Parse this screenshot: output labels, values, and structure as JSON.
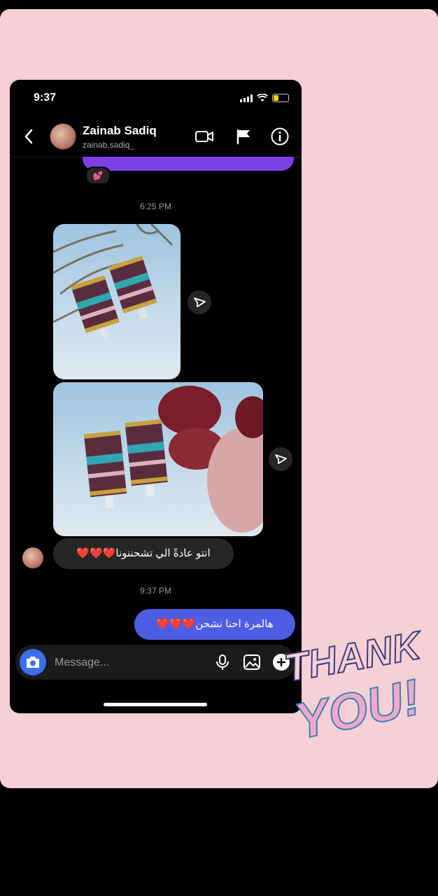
{
  "status_bar": {
    "time": "9:37"
  },
  "header": {
    "name": "Zainab Sadiq",
    "handle": "zainab.sadiq_"
  },
  "conversation": {
    "reaction": "💕",
    "timestamp_1": "6:25 PM",
    "incoming_message": "انتو عادةً الي تشحننونا❤️❤️❤️",
    "timestamp_2": "9:37 PM",
    "outgoing_message": "هالمرة احنا نشحن❤️❤️❤️"
  },
  "composer": {
    "placeholder": "Message..."
  },
  "sticker": {
    "line1": "THANK",
    "line2": "YOU!"
  },
  "colors": {
    "story_bg": "#f6d0d6",
    "outgoing_bubble": "#4e5ee4",
    "camera_button": "#3b6ff0",
    "purple_bubble": "#7b3fe4"
  }
}
